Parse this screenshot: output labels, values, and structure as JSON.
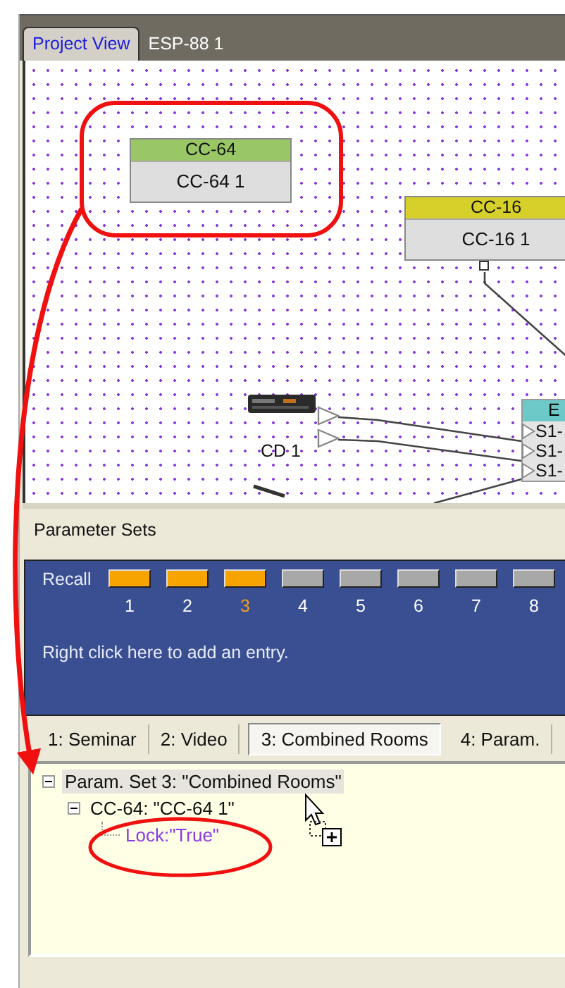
{
  "view_tabs": [
    {
      "label": "Project View",
      "selected": true
    },
    {
      "label": "ESP-88 1",
      "selected": false
    }
  ],
  "canvas": {
    "nodes": [
      {
        "title": "CC-64",
        "name": "CC-64 1",
        "color": "#99c766",
        "kind": "left"
      },
      {
        "title": "CC-16",
        "name": "CC-16 1",
        "color": "#d8d02a",
        "kind": "right"
      }
    ],
    "cd_player": {
      "label": "CD 1"
    },
    "processor": {
      "title": "E",
      "ports": [
        "S1-",
        "S1-",
        "S1-"
      ]
    }
  },
  "parameter_sets": {
    "title": "Parameter Sets",
    "recall_label": "Recall",
    "slots": [
      {
        "number": "1",
        "stored": true,
        "selected": false
      },
      {
        "number": "2",
        "stored": true,
        "selected": false
      },
      {
        "number": "3",
        "stored": true,
        "selected": true
      },
      {
        "number": "4",
        "stored": false,
        "selected": false
      },
      {
        "number": "5",
        "stored": false,
        "selected": false
      },
      {
        "number": "6",
        "stored": false,
        "selected": false
      },
      {
        "number": "7",
        "stored": false,
        "selected": false
      },
      {
        "number": "8",
        "stored": false,
        "selected": false
      }
    ],
    "hint": "Right click here to add an entry."
  },
  "set_tabs": [
    {
      "label": "1: Seminar",
      "selected": false
    },
    {
      "label": "2: Video",
      "selected": false
    },
    {
      "label": "3: Combined Rooms",
      "selected": true
    },
    {
      "label": "4: Param.",
      "selected": false
    }
  ],
  "tree": [
    {
      "label": "Param. Set 3: \"Combined Rooms\"",
      "expanded": true,
      "selected": true,
      "children": [
        {
          "label": "CC-64: \"CC-64 1\"",
          "expanded": true,
          "selected": false,
          "children": [
            {
              "label": "Lock:\"True\"",
              "selected": false,
              "kind": "setting"
            }
          ]
        }
      ]
    }
  ]
}
